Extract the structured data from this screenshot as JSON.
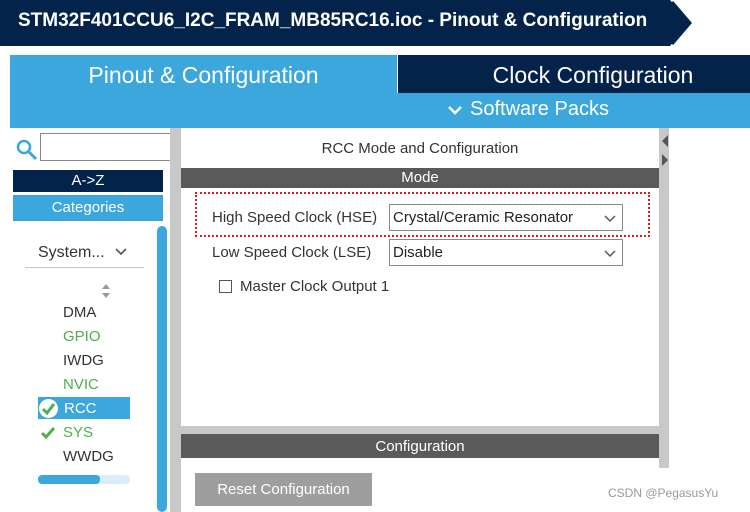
{
  "window": {
    "title": "STM32F401CCU6_I2C_FRAM_MB85RC16.ioc - Pinout & Configuration"
  },
  "tabs": {
    "pinout": "Pinout & Configuration",
    "clock": "Clock Configuration",
    "software_packs": "Software Packs"
  },
  "sidebar": {
    "search": {
      "value": "",
      "placeholder": ""
    },
    "az_label": "A->Z",
    "categories_label": "Categories",
    "category_dropdown": "System...",
    "items": [
      {
        "label": "DMA",
        "color": "#333333",
        "status": "none"
      },
      {
        "label": "GPIO",
        "color": "#4caf50",
        "status": "none"
      },
      {
        "label": "IWDG",
        "color": "#333333",
        "status": "none"
      },
      {
        "label": "NVIC",
        "color": "#4caf50",
        "status": "none"
      },
      {
        "label": "RCC",
        "color": "#ffffff",
        "status": "configured",
        "selected": true
      },
      {
        "label": "SYS",
        "color": "#4caf50",
        "status": "configured"
      },
      {
        "label": "WWDG",
        "color": "#333333",
        "status": "none"
      }
    ]
  },
  "rcc": {
    "title": "RCC Mode and Configuration",
    "mode_header": "Mode",
    "hse_label": "High Speed Clock (HSE)",
    "hse_value": "Crystal/Ceramic Resonator",
    "lse_label": "Low Speed Clock (LSE)",
    "lse_value": "Disable",
    "mco_label": "Master Clock Output 1",
    "mco_checked": false
  },
  "configuration": {
    "header": "Configuration",
    "reset_button": "Reset Configuration"
  },
  "watermark": "CSDN @PegasusYu",
  "colors": {
    "navy": "#03234b",
    "accent_blue": "#3ca7dc",
    "dark_gray_bar": "#5a5a5a",
    "green_check": "#4caf50",
    "highlight_red": "#d81e1e"
  }
}
